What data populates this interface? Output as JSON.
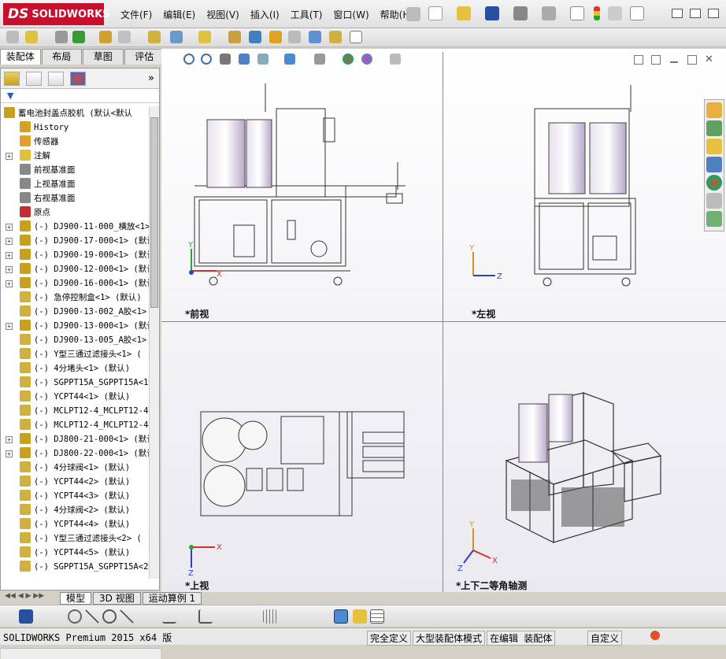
{
  "app": {
    "logo_prefix": "DS",
    "logo_text": "SOLIDWORKS"
  },
  "menu": [
    "文件(F)",
    "编辑(E)",
    "视图(V)",
    "插入(I)",
    "工具(T)",
    "窗口(W)",
    "帮助(H)"
  ],
  "manager_tabs": [
    "装配体",
    "布局",
    "草图",
    "评估"
  ],
  "tree": {
    "root": "蓄电池封盖点胶机  (默认<默认",
    "items": [
      {
        "label": "History",
        "exp": false,
        "icon": "history-icon",
        "color": "#d8a020"
      },
      {
        "label": "传感器",
        "exp": false,
        "icon": "sensor-icon",
        "color": "#e0a030"
      },
      {
        "label": "注解",
        "exp": true,
        "icon": "annotation-icon",
        "color": "#e0c040"
      },
      {
        "label": "前视基准面",
        "exp": false,
        "icon": "plane-icon",
        "color": "#888888"
      },
      {
        "label": "上视基准面",
        "exp": false,
        "icon": "plane-icon",
        "color": "#888888"
      },
      {
        "label": "右视基准面",
        "exp": false,
        "icon": "plane-icon",
        "color": "#888888"
      },
      {
        "label": "原点",
        "exp": false,
        "icon": "origin-icon",
        "color": "#c03030"
      },
      {
        "label": "(-) DJ900-11-000_横放<1>",
        "exp": true,
        "icon": "assembly-icon",
        "color": "#c8a020"
      },
      {
        "label": "(-) DJ900-17-000<1> (默认",
        "exp": true,
        "icon": "assembly-icon",
        "color": "#c8a020"
      },
      {
        "label": "(-) DJ900-19-000<1> (默认",
        "exp": true,
        "icon": "assembly-icon",
        "color": "#c8a020"
      },
      {
        "label": "(-) DJ900-12-000<1> (默认",
        "exp": true,
        "icon": "assembly-icon",
        "color": "#c8a020"
      },
      {
        "label": "(-) DJ900-16-000<1> (默认",
        "exp": true,
        "icon": "assembly-icon",
        "color": "#c8a020"
      },
      {
        "label": "(-) 急停控制盒<1> (默认)",
        "exp": false,
        "icon": "part-icon",
        "color": "#d0b040"
      },
      {
        "label": "(-) DJ900-13-002_A胶<1>",
        "exp": false,
        "icon": "part-icon",
        "color": "#d0b040"
      },
      {
        "label": "(-) DJ900-13-000<1> (默认",
        "exp": true,
        "icon": "assembly-icon",
        "color": "#c8a020"
      },
      {
        "label": "(-) DJ900-13-005_A胶<1>",
        "exp": false,
        "icon": "part-icon",
        "color": "#d0b040"
      },
      {
        "label": "(-) Y型三通过滤接头<1> (",
        "exp": false,
        "icon": "part-icon",
        "color": "#d0b040"
      },
      {
        "label": "(-) 4分堵头<1> (默认)",
        "exp": false,
        "icon": "part-icon",
        "color": "#d0b040"
      },
      {
        "label": "(-) SGPPT15A_SGPPT15A<1>",
        "exp": false,
        "icon": "part-icon",
        "color": "#d0b040"
      },
      {
        "label": "(-) YCPT44<1> (默认)",
        "exp": false,
        "icon": "part-icon",
        "color": "#d0b040"
      },
      {
        "label": "(-) MCLPT12-4_MCLPT12-4<",
        "exp": false,
        "icon": "part-icon",
        "color": "#d0b040"
      },
      {
        "label": "(-) MCLPT12-4_MCLPT12-4<",
        "exp": false,
        "icon": "part-icon",
        "color": "#d0b040"
      },
      {
        "label": "(-) DJ800-21-000<1> (默认",
        "exp": true,
        "icon": "assembly-icon",
        "color": "#c8a020"
      },
      {
        "label": "(-) DJ800-22-000<1> (默认",
        "exp": true,
        "icon": "assembly-icon",
        "color": "#c8a020"
      },
      {
        "label": "(-) 4分球阀<1> (默认)",
        "exp": false,
        "icon": "part-icon",
        "color": "#d0b040"
      },
      {
        "label": "(-) YCPT44<2> (默认)",
        "exp": false,
        "icon": "part-icon",
        "color": "#d0b040"
      },
      {
        "label": "(-) YCPT44<3> (默认)",
        "exp": false,
        "icon": "part-icon",
        "color": "#d0b040"
      },
      {
        "label": "(-) 4分球阀<2> (默认)",
        "exp": false,
        "icon": "part-icon",
        "color": "#d0b040"
      },
      {
        "label": "(-) YCPT44<4> (默认)",
        "exp": false,
        "icon": "part-icon",
        "color": "#d0b040"
      },
      {
        "label": "(-) Y型三通过滤接头<2> (",
        "exp": false,
        "icon": "part-icon",
        "color": "#d0b040"
      },
      {
        "label": "(-) YCPT44<5> (默认)",
        "exp": false,
        "icon": "part-icon",
        "color": "#d0b040"
      },
      {
        "label": "(-) SGPPT15A_SGPPT15A<2>",
        "exp": false,
        "icon": "part-icon",
        "color": "#d0b040"
      }
    ]
  },
  "views": {
    "front": "*前视",
    "left": "*左视",
    "top": "*上视",
    "iso": "*上下二等角轴测"
  },
  "axes": {
    "x": "X",
    "y": "Y",
    "z": "Z"
  },
  "model_tabs": [
    "模型",
    "3D 视图",
    "运动算例 1"
  ],
  "status": {
    "version": "SOLIDWORKS Premium 2015 x64 版",
    "defined": "完全定义",
    "mode": "大型装配体模式",
    "editing": "在编辑 装配体",
    "custom": "自定义"
  }
}
